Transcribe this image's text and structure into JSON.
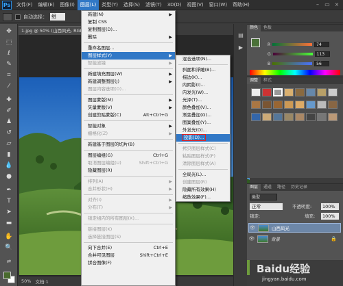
{
  "app": {
    "logo": "Ps"
  },
  "menubar": {
    "items": [
      "文件(F)",
      "编辑(E)",
      "图像(I)",
      "图层(L)",
      "类型(Y)",
      "选择(S)",
      "滤镜(T)",
      "3D(D)",
      "视图(V)",
      "窗口(W)",
      "帮助(H)"
    ],
    "active_index": 3
  },
  "window_controls": {
    "minimize": "–",
    "restore": "▭",
    "close": "×"
  },
  "options": {
    "auto_select_label": "自动选择：",
    "auto_select_value": "组"
  },
  "document": {
    "tab_title": "1.jpg @ 50% (山西风光, RGB",
    "zoom": "50%",
    "status": "文档:1"
  },
  "layer_menu": {
    "items": [
      {
        "label": "新建(N)",
        "arrow": true
      },
      {
        "label": "复制 CSS"
      },
      {
        "label": "复制图层(D)..."
      },
      {
        "label": "删除",
        "arrow": true
      },
      {
        "sep": true
      },
      {
        "label": "重命名图层..."
      },
      {
        "label": "图层样式(Y)",
        "arrow": true,
        "highlight": true
      },
      {
        "label": "智能滤镜",
        "disabled": true,
        "arrow": true
      },
      {
        "sep": true
      },
      {
        "label": "新建填充图层(W)",
        "arrow": true
      },
      {
        "label": "新建调整图层(J)",
        "arrow": true
      },
      {
        "label": "图层内容选项(O)...",
        "disabled": true
      },
      {
        "sep": true
      },
      {
        "label": "图层蒙版(M)",
        "arrow": true
      },
      {
        "label": "矢量蒙版(V)",
        "arrow": true
      },
      {
        "label": "创建剪贴蒙版(C)",
        "shortcut": "Alt+Ctrl+G"
      },
      {
        "sep": true
      },
      {
        "label": "智能对象",
        "arrow": true
      },
      {
        "label": "栅格化(Z)",
        "arrow": true,
        "disabled": true
      },
      {
        "sep": true
      },
      {
        "label": "新建基于图层的切片(B)"
      },
      {
        "sep": true
      },
      {
        "label": "图层编组(G)",
        "shortcut": "Ctrl+G"
      },
      {
        "label": "取消图层编组(U)",
        "shortcut": "Shift+Ctrl+G",
        "disabled": true
      },
      {
        "label": "隐藏图层(R)"
      },
      {
        "sep": true
      },
      {
        "label": "排列(A)",
        "arrow": true,
        "disabled": true
      },
      {
        "label": "合并形状(H)",
        "arrow": true,
        "disabled": true
      },
      {
        "sep": true
      },
      {
        "label": "对齐(I)",
        "arrow": true,
        "disabled": true
      },
      {
        "label": "分布(T)",
        "arrow": true,
        "disabled": true
      },
      {
        "sep": true
      },
      {
        "label": "锁定组内的所有图层(X)...",
        "disabled": true
      },
      {
        "sep": true
      },
      {
        "label": "链接图层(K)",
        "disabled": true
      },
      {
        "label": "选择链接图层(S)",
        "disabled": true
      },
      {
        "sep": true
      },
      {
        "label": "向下合并(E)",
        "shortcut": "Ctrl+E"
      },
      {
        "label": "合并可见图层",
        "shortcut": "Shift+Ctrl+E"
      },
      {
        "label": "拼合图像(F)"
      }
    ]
  },
  "style_submenu": {
    "items": [
      {
        "label": "混合选项(N)..."
      },
      {
        "sep": true
      },
      {
        "label": "斜面和浮雕(B)..."
      },
      {
        "label": "描边(K)..."
      },
      {
        "label": "内阴影(I)..."
      },
      {
        "label": "内发光(W)..."
      },
      {
        "label": "光泽(T)..."
      },
      {
        "label": "颜色叠加(V)..."
      },
      {
        "label": "渐变叠加(G)..."
      },
      {
        "label": "图案叠加(Y)..."
      },
      {
        "label": "外发光(O)..."
      },
      {
        "label": "投影(D)...",
        "highlight": true,
        "boxed": true
      },
      {
        "sep": true
      },
      {
        "label": "拷贝图层样式(C)",
        "disabled": true
      },
      {
        "label": "粘贴图层样式(P)",
        "disabled": true
      },
      {
        "label": "清除图层样式(A)",
        "disabled": true
      },
      {
        "sep": true
      },
      {
        "label": "全局光(L)..."
      },
      {
        "label": "创建图层(R)",
        "disabled": true
      },
      {
        "label": "隐藏所有效果(H)"
      },
      {
        "label": "缩放效果(F)..."
      }
    ]
  },
  "color_panel": {
    "tabs": [
      "颜色",
      "色板"
    ],
    "channels": [
      {
        "name": "R",
        "value": "74"
      },
      {
        "name": "G",
        "value": "113"
      },
      {
        "name": "B",
        "value": "56"
      }
    ],
    "foreground": "#4a7138"
  },
  "adjust_panel": {
    "tabs": [
      "调整",
      "样式"
    ]
  },
  "layers_panel": {
    "tabs": [
      "图层",
      "通道",
      "路径",
      "历史记录"
    ],
    "kind_label": "类型",
    "blend_mode": "正常",
    "opacity_label": "不透明度:",
    "opacity_value": "100%",
    "lock_label": "锁定:",
    "fill_label": "填充:",
    "fill_value": "100%",
    "layers": [
      {
        "name": "山西风光",
        "selected": true
      },
      {
        "name": "背景",
        "italic": true
      }
    ]
  },
  "watermark": {
    "brand": "Baidu经验",
    "url": "jingyan.baidu.com"
  },
  "colors": {
    "accent": "#3178c6",
    "panel": "#535353",
    "menu_bg": "#f0f0f0",
    "red_box": "#e02020"
  }
}
